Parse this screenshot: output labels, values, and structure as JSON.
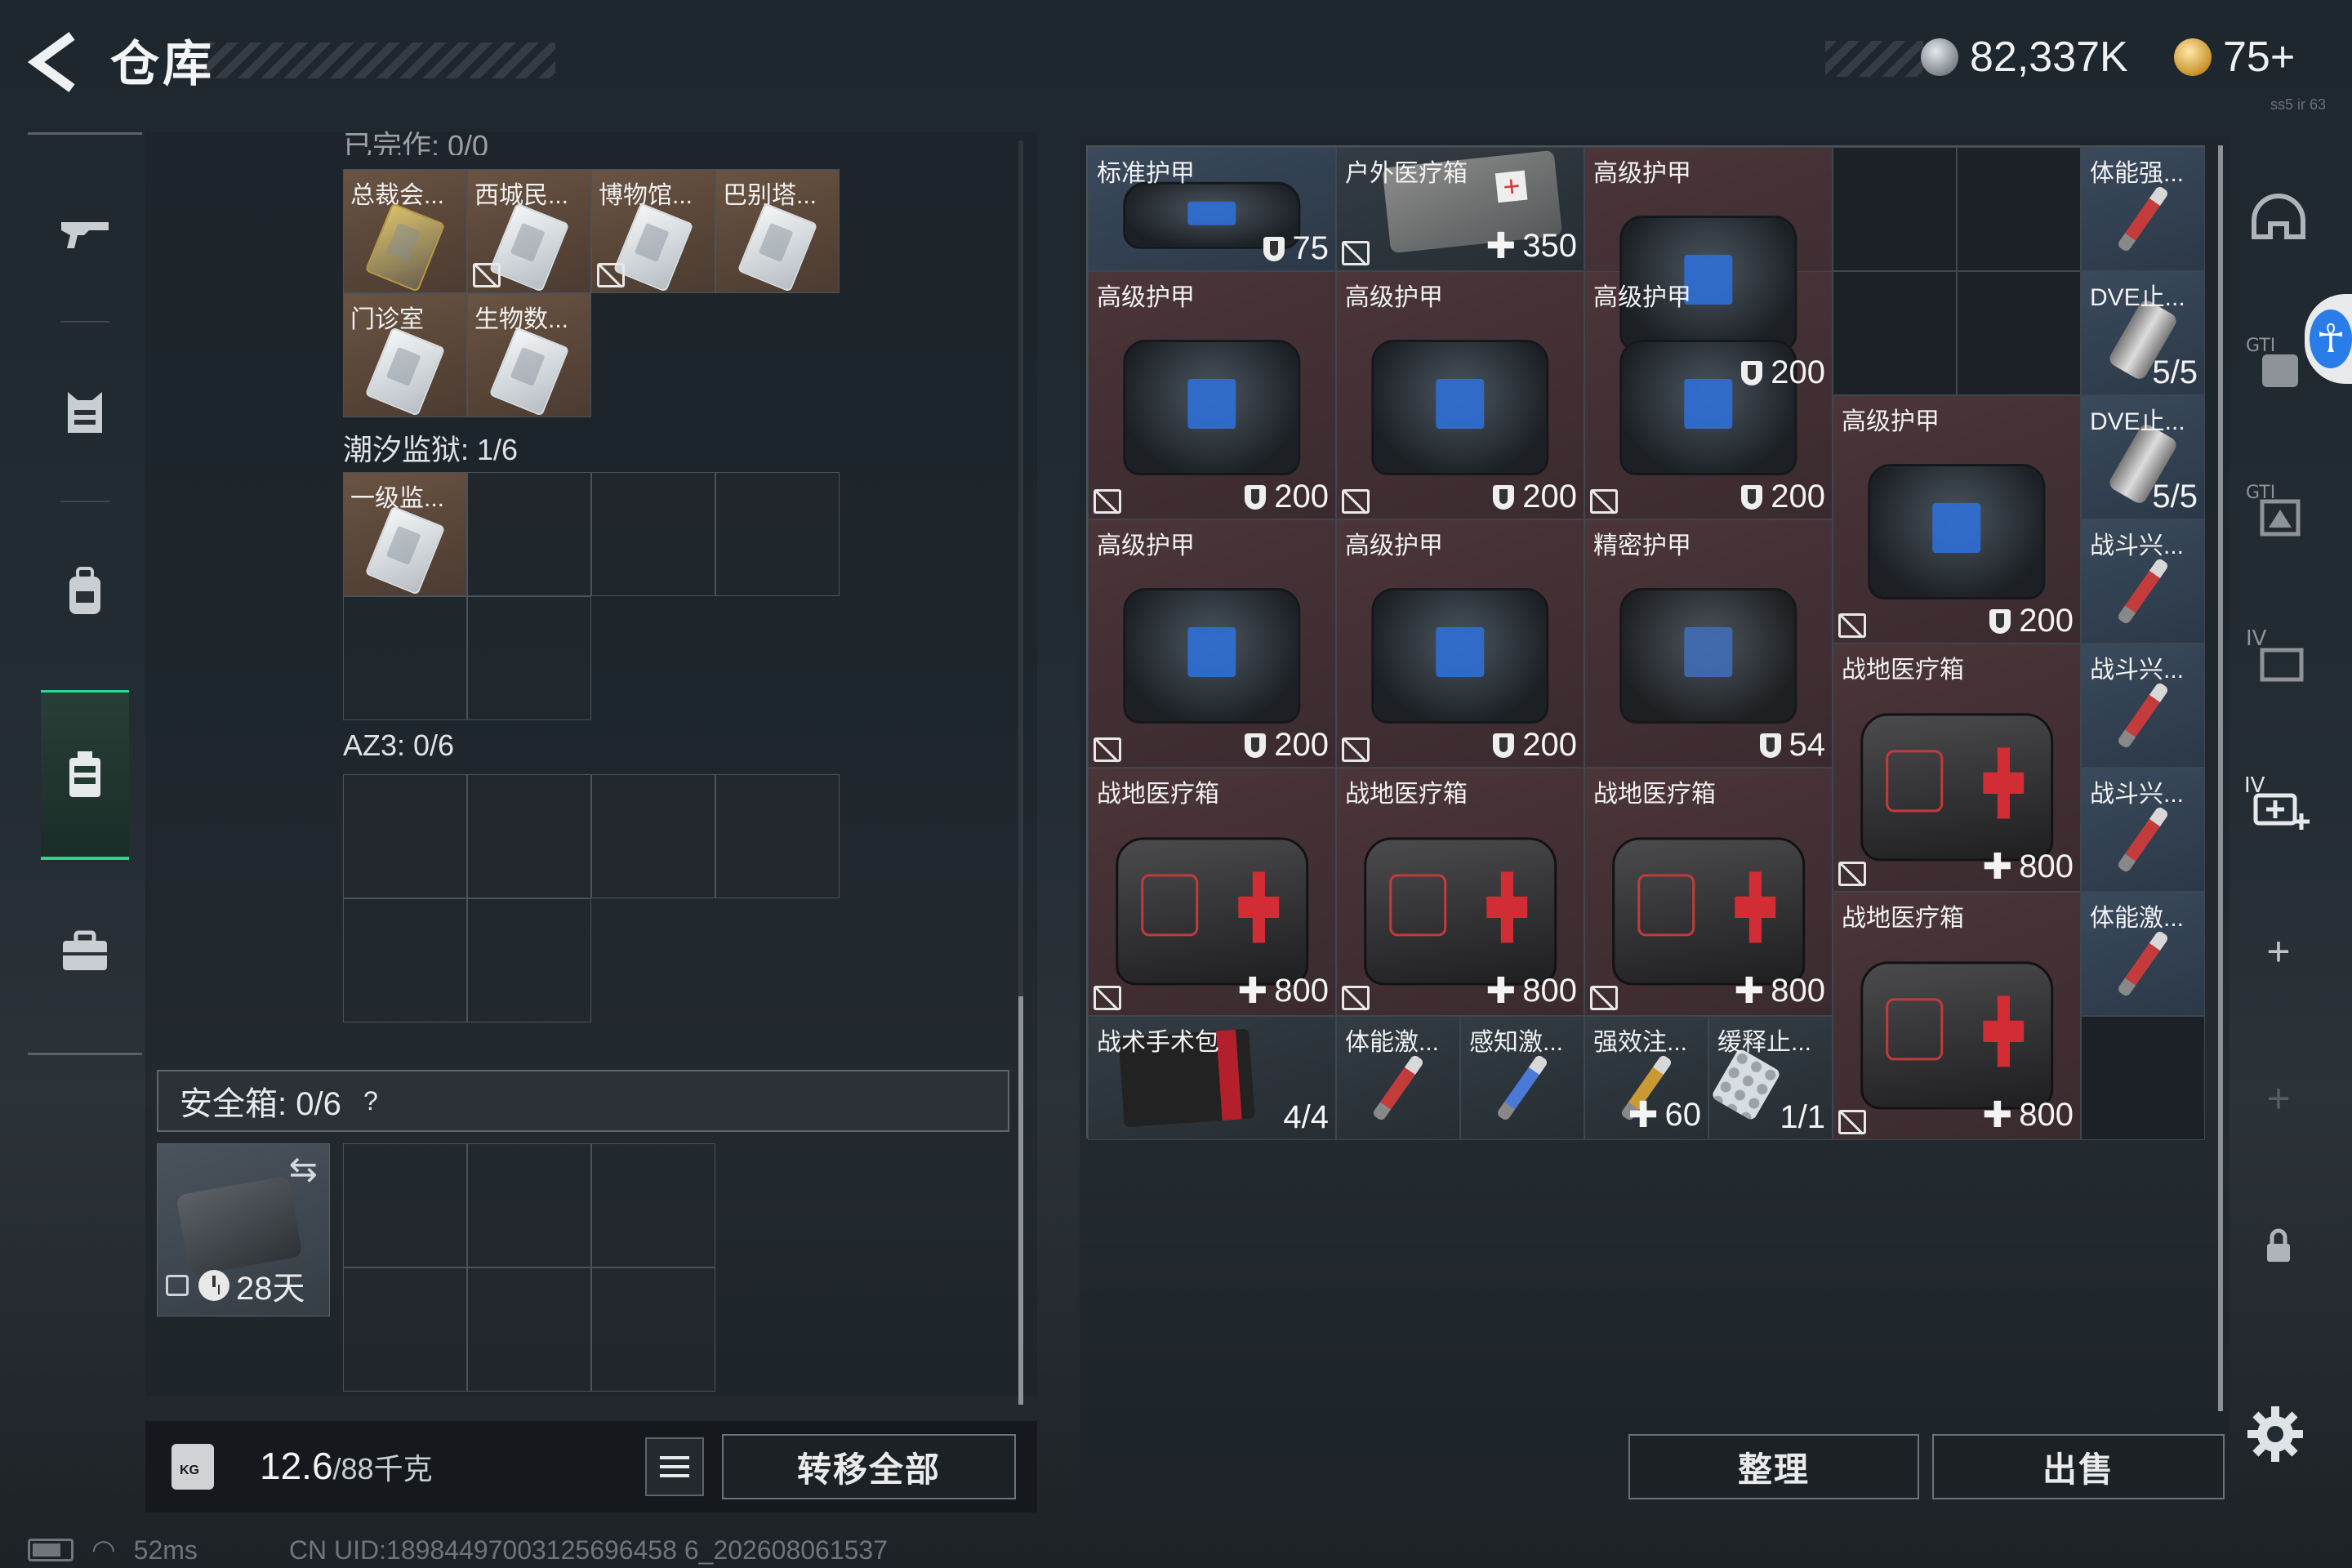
{
  "header": {
    "title": "仓库",
    "back_icon": "back-arrow-icon"
  },
  "currency": {
    "coins": "82,337K",
    "coins_icon": "hafbucks-coin-icon",
    "tokens": "75+",
    "tokens_icon": "triangle-token-icon"
  },
  "version_tag": "ss5 ir 63",
  "nav": {
    "items": [
      {
        "name": "weapon",
        "icon": "rifle-icon"
      },
      {
        "name": "armor",
        "icon": "vest-icon"
      },
      {
        "name": "backpack",
        "icon": "backpack-icon"
      },
      {
        "name": "rig",
        "icon": "chest-rig-icon",
        "active": true
      },
      {
        "name": "case",
        "icon": "briefcase-icon"
      }
    ]
  },
  "left": {
    "top_cut_label": "已完作: 0/0",
    "keycard_group_1": [
      {
        "name": "总裁会...",
        "style": "gold",
        "no_insure": false
      },
      {
        "name": "西城民...",
        "style": "silver",
        "no_insure": true
      },
      {
        "name": "博物馆...",
        "style": "silver",
        "no_insure": true
      },
      {
        "name": "巴别塔...",
        "style": "silver",
        "no_insure": false
      },
      {
        "name": "门诊室",
        "style": "silver",
        "no_insure": false
      },
      {
        "name": "生物数...",
        "style": "silver",
        "no_insure": false
      }
    ],
    "tidal_prison": {
      "label": "潮汐监狱: 1/6",
      "items": [
        {
          "name": "一级监...",
          "style": "silver"
        }
      ]
    },
    "az3": {
      "label": "AZ3: 0/6"
    },
    "safe_box": {
      "label": "安全箱: 0/6",
      "help": "?",
      "days": "28天",
      "swap_icon": "swap-arrows-icon",
      "lock_icon": "padlock-icon",
      "clock_icon": "clock-icon"
    },
    "weight": {
      "current": "12.6",
      "max": "/88千克",
      "icon": "kg-weight-icon"
    },
    "list_icon": "list-view-icon",
    "transfer_all": "转移全部"
  },
  "inventory": {
    "items": [
      {
        "name": "标准护甲",
        "kind": "vest",
        "bg": "blue",
        "value": "75",
        "val_icon": "shield",
        "no_insure": false
      },
      {
        "name": "户外医疗箱",
        "kind": "outdoor",
        "bg": "dark",
        "value": "350",
        "val_icon": "plus",
        "no_insure": true
      },
      {
        "name": "高级护甲",
        "kind": "vest",
        "bg": "red",
        "value": "200",
        "val_icon": "shield",
        "no_insure": true
      },
      {
        "name": "体能强...",
        "kind": "syringe-red",
        "bg": "blue"
      },
      {
        "name": "DVE止...",
        "kind": "canister",
        "bg": "blue",
        "value": "5/5"
      },
      {
        "name": "高级护甲",
        "kind": "vest",
        "bg": "red",
        "value": "200",
        "val_icon": "shield",
        "no_insure": true
      },
      {
        "name": "高级护甲",
        "kind": "vest",
        "bg": "red",
        "value": "200",
        "val_icon": "shield",
        "no_insure": true
      },
      {
        "name": "高级护甲",
        "kind": "vest",
        "bg": "red",
        "value": "200",
        "val_icon": "shield",
        "no_insure": true
      },
      {
        "name": "DVE止...",
        "kind": "canister",
        "bg": "blue",
        "value": "5/5"
      },
      {
        "name": "高级护甲",
        "kind": "vest",
        "bg": "red",
        "value": "200",
        "val_icon": "shield",
        "no_insure": true
      },
      {
        "name": "高级护甲",
        "kind": "vest",
        "bg": "red",
        "value": "200",
        "val_icon": "shield",
        "no_insure": true
      },
      {
        "name": "高级护甲",
        "kind": "vest",
        "bg": "red",
        "value": "200",
        "val_icon": "shield",
        "no_insure": true
      },
      {
        "name": "精密护甲",
        "kind": "vest-plain",
        "bg": "red",
        "value": "54",
        "val_icon": "shield",
        "no_insure": false
      },
      {
        "name": "战斗兴...",
        "kind": "syringe-red",
        "bg": "blue"
      },
      {
        "name": "战地医疗箱",
        "kind": "medkit",
        "bg": "red",
        "value": "800",
        "val_icon": "plus",
        "no_insure": true
      },
      {
        "name": "战斗兴...",
        "kind": "syringe-red",
        "bg": "blue"
      },
      {
        "name": "战地医疗箱",
        "kind": "medkit",
        "bg": "red",
        "value": "800",
        "val_icon": "plus",
        "no_insure": true
      },
      {
        "name": "战地医疗箱",
        "kind": "medkit",
        "bg": "red",
        "value": "800",
        "val_icon": "plus",
        "no_insure": true
      },
      {
        "name": "战地医疗箱",
        "kind": "medkit",
        "bg": "red",
        "value": "800",
        "val_icon": "plus",
        "no_insure": true
      },
      {
        "name": "战斗兴...",
        "kind": "syringe-red",
        "bg": "blue"
      },
      {
        "name": "战地医疗箱",
        "kind": "medkit",
        "bg": "red",
        "value": "800",
        "val_icon": "plus",
        "no_insure": true
      },
      {
        "name": "体能激...",
        "kind": "syringe-red",
        "bg": "blue"
      },
      {
        "name": "战术手术包",
        "kind": "surgical",
        "bg": "dark",
        "value": "4/4"
      },
      {
        "name": "体能激...",
        "kind": "syringe-red",
        "bg": "dark"
      },
      {
        "name": "感知激...",
        "kind": "syringe-blue",
        "bg": "dark"
      },
      {
        "name": "强效注...",
        "kind": "syringe-gold",
        "bg": "dark",
        "value": "60",
        "val_icon": "plus"
      },
      {
        "name": "缓释止...",
        "kind": "pills",
        "bg": "dark",
        "value": "1/1"
      }
    ],
    "sort": "整理",
    "sell": "出售"
  },
  "right_strip": {
    "items": [
      "helmet-slot-icon",
      "gti-armor-icon",
      "gti-rig-icon",
      "iv-folder-icon",
      "iv-medkit-add-icon",
      "plus-icon",
      "plus-icon",
      "padlock-icon"
    ],
    "accessibility_icon": "accessibility-person-icon",
    "settings_icon": "gear-icon"
  },
  "status": {
    "ping": "52ms",
    "uid": "CN UID:18984497003125696458 6_202608061537",
    "battery_icon": "battery-icon",
    "wifi_icon": "wifi-icon"
  },
  "colors": {
    "accent_green": "#28d98c",
    "armor_red": "#4b3539",
    "consumable_blue": "#3a4a5c",
    "a11y_blue": "#2a7de8"
  }
}
